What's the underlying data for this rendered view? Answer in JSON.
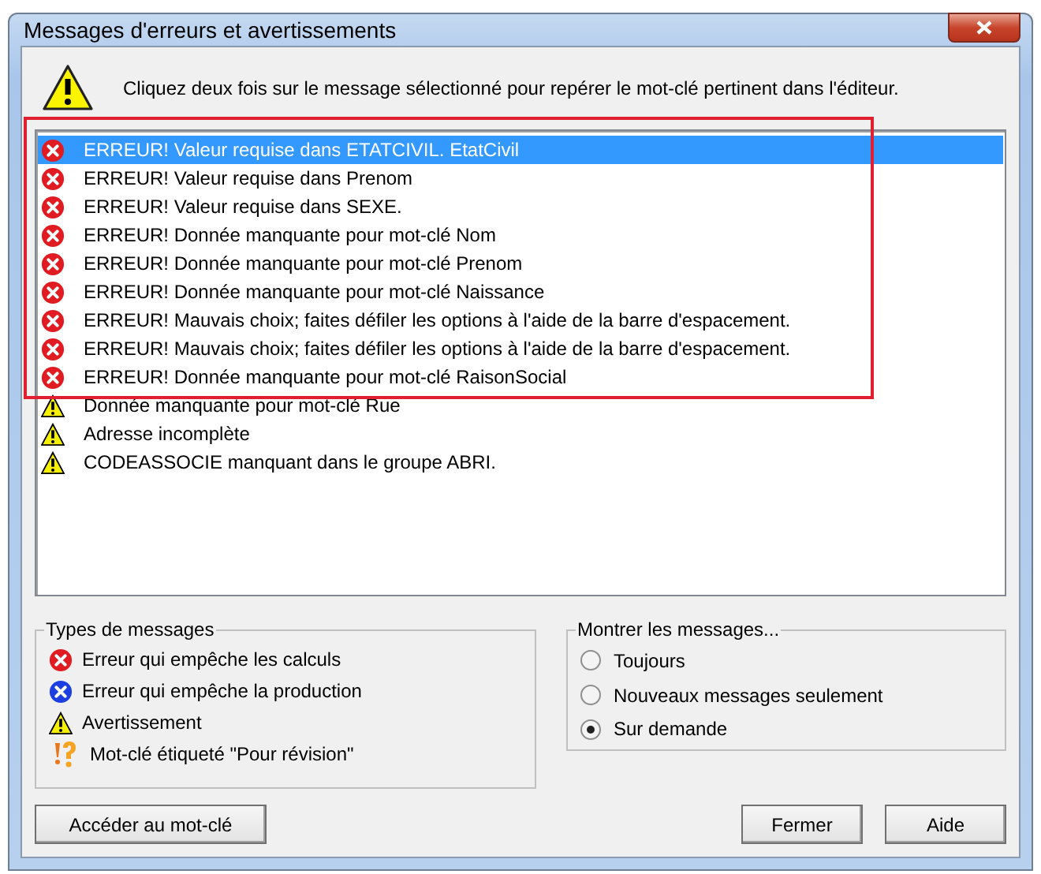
{
  "window": {
    "title": "Messages d'erreurs et avertissements"
  },
  "instruction": "Cliquez deux fois sur le message sélectionné pour repérer le mot-clé pertinent dans l'éditeur.",
  "messages": [
    {
      "kind": "error",
      "text": "ERREUR! Valeur requise dans ETATCIVIL. EtatCivil",
      "selected": true
    },
    {
      "kind": "error",
      "text": "ERREUR! Valeur requise dans Prenom",
      "selected": false
    },
    {
      "kind": "error",
      "text": "ERREUR! Valeur requise dans SEXE.",
      "selected": false
    },
    {
      "kind": "error",
      "text": "ERREUR! Donnée manquante pour mot-clé Nom",
      "selected": false
    },
    {
      "kind": "error",
      "text": "ERREUR! Donnée manquante pour mot-clé Prenom",
      "selected": false
    },
    {
      "kind": "error",
      "text": "ERREUR! Donnée manquante pour mot-clé Naissance",
      "selected": false
    },
    {
      "kind": "error",
      "text": "ERREUR! Mauvais choix; faites défiler les options à l'aide de la barre d'espacement.",
      "selected": false
    },
    {
      "kind": "error",
      "text": "ERREUR! Mauvais choix; faites défiler les options à l'aide de la barre d'espacement.",
      "selected": false
    },
    {
      "kind": "error",
      "text": "ERREUR! Donnée manquante pour mot-clé RaisonSocial",
      "selected": false
    },
    {
      "kind": "warning",
      "text": "Donnée manquante pour mot-clé Rue",
      "selected": false
    },
    {
      "kind": "warning",
      "text": "Adresse incomplète",
      "selected": false
    },
    {
      "kind": "warning",
      "text": "CODEASSOCIE manquant dans le groupe ABRI.",
      "selected": false
    }
  ],
  "types_group": {
    "title": "Types de messages",
    "items": [
      {
        "kind": "error",
        "label": "Erreur qui empêche les calculs"
      },
      {
        "kind": "production",
        "label": "Erreur qui empêche la production"
      },
      {
        "kind": "warning",
        "label": "Avertissement"
      },
      {
        "kind": "review",
        "label": "Mot-clé étiqueté \"Pour révision\""
      }
    ]
  },
  "show_group": {
    "title": "Montrer les messages...",
    "options": [
      {
        "label": "Toujours",
        "selected": false
      },
      {
        "label": "Nouveaux messages seulement",
        "selected": false
      },
      {
        "label": "Sur demande",
        "selected": true
      }
    ]
  },
  "buttons": {
    "goto": "Accéder au mot-clé",
    "close": "Fermer",
    "help": "Aide"
  }
}
